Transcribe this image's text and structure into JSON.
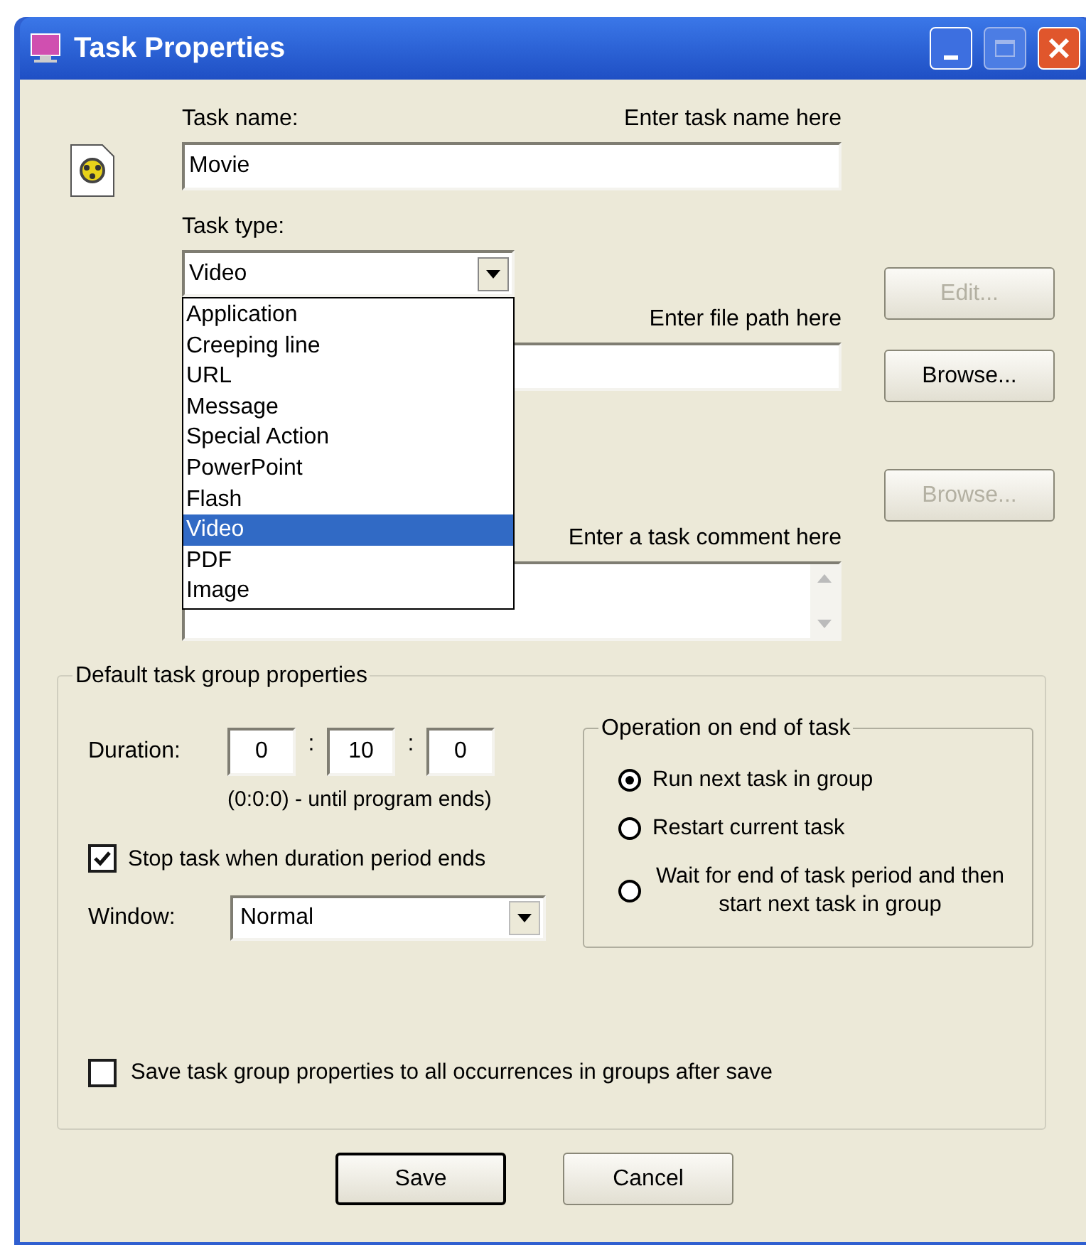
{
  "window": {
    "title": "Task Properties"
  },
  "task_name": {
    "label": "Task name:",
    "hint": "Enter task name here",
    "value": "Movie"
  },
  "task_type": {
    "label": "Task type:",
    "value": "Video",
    "expanded": true,
    "options": [
      {
        "label": "Application",
        "selected": false
      },
      {
        "label": "Creeping line",
        "selected": false
      },
      {
        "label": "URL",
        "selected": false
      },
      {
        "label": "Message",
        "selected": false
      },
      {
        "label": "Special Action",
        "selected": false
      },
      {
        "label": "PowerPoint",
        "selected": false
      },
      {
        "label": "Flash",
        "selected": false
      },
      {
        "label": "Video",
        "selected": true
      },
      {
        "label": "PDF",
        "selected": false
      },
      {
        "label": "Image",
        "selected": false
      }
    ]
  },
  "file_path": {
    "hint": "Enter file path here"
  },
  "comment": {
    "hint": "Enter a task comment here"
  },
  "side_buttons": [
    {
      "label": "Edit...",
      "disabled": true
    },
    {
      "label": "Browse...",
      "disabled": false
    },
    {
      "label": "Browse...",
      "disabled": true
    }
  ],
  "group": {
    "title": "Default task group properties",
    "duration": {
      "label": "Duration:",
      "fields": [
        "0",
        "10",
        "0"
      ],
      "separators": [
        ":",
        ":"
      ],
      "hint": "(0:0:0) - until program ends)"
    },
    "stop_task": {
      "label": "Stop task when duration period ends",
      "checked": true
    },
    "window_mode": {
      "label": "Window:",
      "value": "Normal"
    },
    "operation": {
      "title": "Operation on end of task",
      "options": [
        {
          "label": "Run next task in group",
          "selected": true
        },
        {
          "label": "Restart current task",
          "selected": false
        },
        {
          "label": "Wait for end of task period and then start next task in group",
          "selected": false
        }
      ]
    },
    "save_all": {
      "label": "Save task group properties to all occurrences in groups after save",
      "checked": false
    }
  },
  "buttons": [
    {
      "label": "Save",
      "default": true
    },
    {
      "label": "Cancel",
      "default": false
    }
  ]
}
